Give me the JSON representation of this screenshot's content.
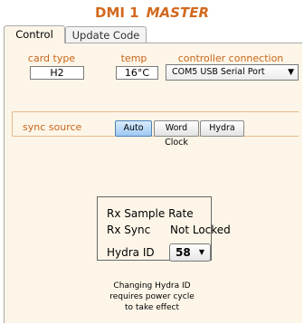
{
  "header": {
    "device": "DMI 1",
    "role": "MASTER"
  },
  "tabs": [
    {
      "label": "Control",
      "active": true
    },
    {
      "label": "Update Code",
      "active": false
    }
  ],
  "status": {
    "card_type_label": "card type",
    "card_type": "H2",
    "temp_label": "temp",
    "temp": "16°C",
    "connection_label": "controller connection",
    "connection": "COM5 USB Serial Port"
  },
  "sync": {
    "label": "sync source",
    "options": [
      "Auto",
      "Word Clock",
      "Hydra"
    ],
    "selected": "Auto"
  },
  "rx": {
    "sample_rate_label": "Rx Sample Rate",
    "sync_label": "Rx Sync",
    "sync_value": "Not Locked",
    "hydra_id_label": "Hydra ID",
    "hydra_id": "58"
  },
  "note": {
    "line1": "Changing Hydra ID",
    "line2": "requires power cycle",
    "line3": "to take effect"
  },
  "colors": {
    "accent": "#c8651b",
    "panel": "#fdf6e8",
    "active_button": "#9ec9f2"
  }
}
